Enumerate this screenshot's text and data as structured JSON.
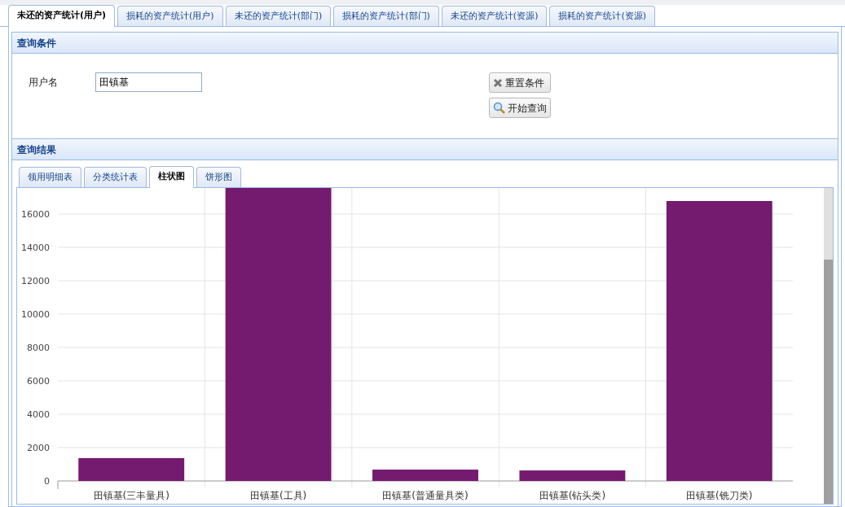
{
  "tabs": [
    {
      "label": "未还的资产统计(用户)",
      "selected": true
    },
    {
      "label": "损耗的资产统计(用户)",
      "selected": false
    },
    {
      "label": "未还的资产统计(部门)",
      "selected": false
    },
    {
      "label": "损耗的资产统计(部门)",
      "selected": false
    },
    {
      "label": "未还的资产统计(资源)",
      "selected": false
    },
    {
      "label": "损耗的资产统计(资源)",
      "selected": false
    }
  ],
  "query_panel": {
    "title": "查询条件",
    "field_label": "用户名",
    "field_value": "田镇基",
    "buttons": [
      {
        "label": "重置条件",
        "kind": "reset"
      },
      {
        "label": "开始查询",
        "kind": "search"
      }
    ]
  },
  "result_panel": {
    "title": "查询结果",
    "tabs": [
      {
        "label": "领用明细表",
        "selected": false
      },
      {
        "label": "分类统计表",
        "selected": false
      },
      {
        "label": "柱状图",
        "selected": true
      },
      {
        "label": "饼形图",
        "selected": false
      }
    ],
    "chart_data": {
      "type": "bar",
      "categories": [
        "田镇基(三丰量具)",
        "田镇基(工具)",
        "田镇基(普通量具类)",
        "田镇基(钻头类)",
        "田镇基(铣刀类)"
      ],
      "series": [
        {
          "color": "#741a6f",
          "values": [
            1370,
            17560,
            680,
            630,
            16780
          ]
        }
      ],
      "grid": true,
      "ylim": [
        0,
        17560
      ],
      "yticks": [
        0,
        2000,
        4000,
        6000,
        8000,
        10000,
        12000,
        14000,
        16000
      ]
    }
  }
}
